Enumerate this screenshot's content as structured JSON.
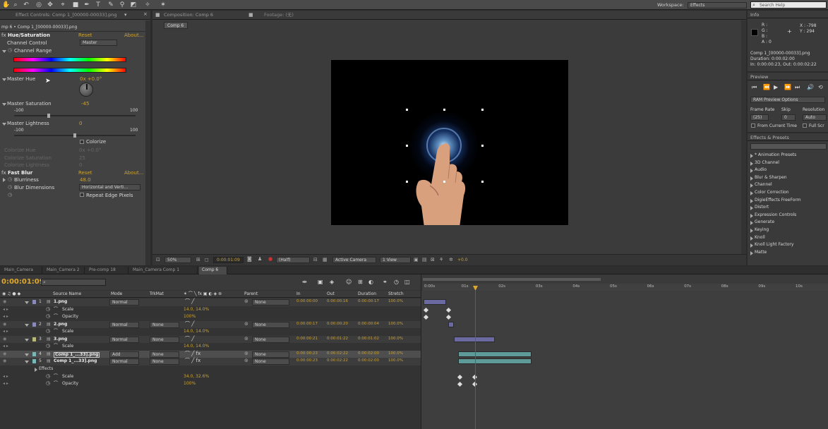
{
  "toolbar": {
    "workspace_label": "Workspace:",
    "workspace_value": "Effects",
    "search_placeholder": "Search Help"
  },
  "effect_controls": {
    "tab_title": "Effect Controls: Comp 1_[00000-00033].png",
    "breadcrumb": "mp 6 • Comp 1_[00000-00033].png",
    "hue_sat": {
      "name": "Hue/Saturation",
      "reset": "Reset",
      "about": "About...",
      "channel_control_label": "Channel Control",
      "channel_control_value": "Master",
      "channel_range_label": "Channel Range",
      "master_hue_label": "Master Hue",
      "master_hue_value": "0x +0.0°",
      "master_sat_label": "Master Saturation",
      "master_sat_value": "-45",
      "master_sat_min": "-100",
      "master_sat_max": "100",
      "master_light_label": "Master Lightness",
      "master_light_value": "0",
      "master_light_min": "-100",
      "master_light_max": "100",
      "colorize_label": "Colorize",
      "colorize_hue_label": "Colorize Hue",
      "colorize_hue_value": "0x +0.0°",
      "colorize_sat_label": "Colorize Saturation",
      "colorize_sat_value": "25",
      "colorize_light_label": "Colorize Lightness",
      "colorize_light_value": "0"
    },
    "fast_blur": {
      "name": "Fast Blur",
      "reset": "Reset",
      "about": "About...",
      "blurriness_label": "Blurriness",
      "blurriness_value": "48.0",
      "blur_dim_label": "Blur Dimensions",
      "blur_dim_value": "Horizontal and Verti...",
      "repeat_label": "Repeat Edge Pixels"
    }
  },
  "composition": {
    "tab_title": "Composition: Comp 6",
    "footage_tab": "Footage: (无)",
    "comp_tab": "Comp 6",
    "zoom": "50%",
    "timecode": "0:00:01:09",
    "resolution": "(Half)",
    "camera": "Active Camera",
    "view": "1 View",
    "exposure": "+0.0"
  },
  "info": {
    "tab": "Info",
    "r": "R :",
    "g": "G :",
    "b": "B :",
    "a": "A : 0",
    "x": "X : -798",
    "y": "Y : 294",
    "file": "Comp 1_[00000-00033].png",
    "duration": "Duration: 0:00:02:00",
    "inout": "In: 0:00:00:23, Out: 0:00:02:22"
  },
  "preview": {
    "tab": "Preview",
    "ram_options": "RAM Preview Options",
    "frame_rate_label": "Frame Rate",
    "skip_label": "Skip",
    "resolution_label": "Resolution",
    "frame_rate_value": "(25)",
    "skip_value": "0",
    "resolution_value": "Auto",
    "from_current": "From Current Time",
    "full_screen": "Full Scr"
  },
  "effects_presets": {
    "tab": "Effects & Presets",
    "items": [
      "* Animation Presets",
      "3D Channel",
      "Audio",
      "Blur & Sharpen",
      "Channel",
      "Color Correction",
      "DigieEffects FreeForm",
      "Distort",
      "Expression Controls",
      "Generate",
      "Keying",
      "Knoll",
      "Knoll Light Factory",
      "Matte"
    ]
  },
  "timeline": {
    "tabs": [
      "Main_Camera",
      "Main_Camera 2",
      "Pre-comp 18",
      "Main_Camera Comp 1",
      "Comp 6"
    ],
    "timecode": "0:00:01:09",
    "columns": {
      "source": "Source Name",
      "mode": "Mode",
      "trkmat": "TrkMat",
      "parent": "Parent",
      "in": "In",
      "out": "Out",
      "duration": "Duration",
      "stretch": "Stretch"
    },
    "ruler": [
      "0:00s",
      "01s",
      "02s",
      "03s",
      "04s",
      "05s",
      "06s",
      "07s",
      "08s",
      "09s",
      "10s"
    ],
    "layers": [
      {
        "num": "1",
        "name": "1.png",
        "mode": "Normal",
        "trkmat": "",
        "parent": "None",
        "in": "0:00:00:00",
        "out": "0:00:00:16",
        "duration": "0:00:00:17",
        "stretch": "100.0%"
      },
      {
        "num": "2",
        "name": "2.png",
        "mode": "Normal",
        "trkmat": "None",
        "parent": "None",
        "in": "0:00:00:17",
        "out": "0:00:00:20",
        "duration": "0:00:00:04",
        "stretch": "100.0%"
      },
      {
        "num": "3",
        "name": "3.png",
        "mode": "Normal",
        "trkmat": "None",
        "parent": "None",
        "in": "0:00:00:21",
        "out": "0:00:01:22",
        "duration": "0:00:01:02",
        "stretch": "100.0%"
      },
      {
        "num": "4",
        "name": "Comp 1_...33].png",
        "mode": "Add",
        "trkmat": "None",
        "parent": "None",
        "in": "0:00:00:23",
        "out": "0:00:02:22",
        "duration": "0:00:02:00",
        "stretch": "100.0%"
      },
      {
        "num": "5",
        "name": "Comp 1_...33].png",
        "mode": "Normal",
        "trkmat": "None",
        "parent": "None",
        "in": "0:00:00:23",
        "out": "0:00:02:22",
        "duration": "0:00:02:00",
        "stretch": "100.0%"
      }
    ],
    "props": {
      "scale": "Scale",
      "opacity": "Opacity",
      "effects": "Effects",
      "l1_scale": "14.0, 14.0%",
      "l1_opacity": "100%",
      "l2_scale": "14.0, 14.0%",
      "l3_scale": "14.0, 14.0%",
      "l5_scale": "34.0, 32.6%",
      "l5_opacity": "100%"
    }
  }
}
